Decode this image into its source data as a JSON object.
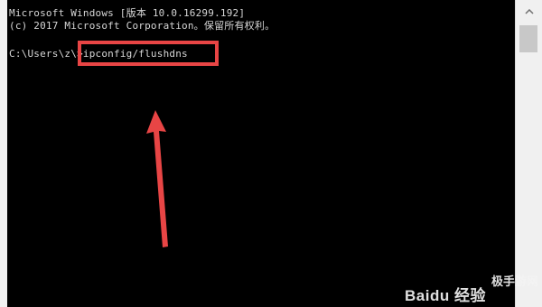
{
  "console": {
    "line1": "Microsoft Windows [版本 10.0.16299.192]",
    "line2": "(c) 2017 Microsoft Corporation。保留所有权利。",
    "prompt": "C:\\Users\\z\\",
    "command": ">ipconfig/flushdns"
  },
  "annotation": {
    "box_color": "#e84545",
    "arrow_color": "#e84545"
  },
  "watermark": {
    "logo": "Baidu 经验",
    "site": "极手游网"
  },
  "icons": {
    "scroll_up": "chevron-up-icon"
  }
}
